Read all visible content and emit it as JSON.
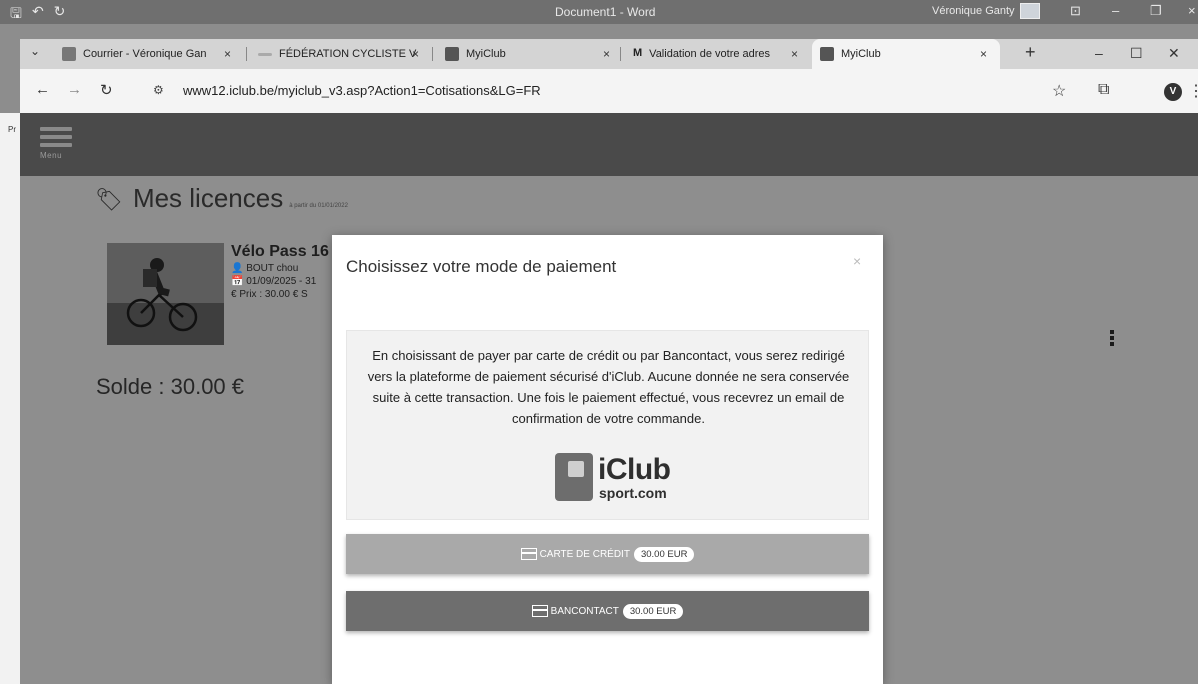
{
  "word": {
    "document_title": "Document1 - Word",
    "user_name": "Véronique Ganty"
  },
  "browser": {
    "tabs": [
      {
        "label": "Courrier - Véronique Gan",
        "active": false
      },
      {
        "label": "FÉDÉRATION CYCLISTE V",
        "active": false
      },
      {
        "label": "MyiClub",
        "active": false
      },
      {
        "label": "Validation de votre adres",
        "active": false
      },
      {
        "label": "MyiClub",
        "active": true
      }
    ],
    "url": "www12.iclub.be/myiclub_v3.asp?Action1=Cotisations&LG=FR",
    "profile_initial": "V"
  },
  "word_margin_label": "Pr",
  "app": {
    "menu_label": "Menu",
    "page_title": "Mes licences",
    "page_subtitle": "à partir du 01/01/2022",
    "licence": {
      "name": "Vélo Pass 16",
      "holder": "BOUT chou",
      "dates": "01/09/2025 - 31",
      "price": "€ Prix : 30.00 €  S"
    },
    "balance": "Solde : 30.00 €"
  },
  "modal": {
    "title": "Choisissez votre mode de paiement",
    "close_glyph": "×",
    "info": "En choisissant de payer par carte de crédit ou par Bancontact, vous serez redirigé vers la plateforme de paiement sécurisé d'iClub. Aucune donnée ne sera conservée suite à cette transaction. Une fois le paiement effectué, vous recevrez un email de confirmation de votre commande.",
    "logo": {
      "brand": "iClub",
      "sub": "sport.com"
    },
    "buttons": [
      {
        "label": "Carte de crédit",
        "amount": "30.00 EUR"
      },
      {
        "label": "Bancontact",
        "amount": "30.00 EUR"
      }
    ]
  },
  "colors": {
    "header_bg": "#4a4a4a",
    "credit_button": "#a9a9a9",
    "bancontact_button": "#6e6e6e"
  }
}
